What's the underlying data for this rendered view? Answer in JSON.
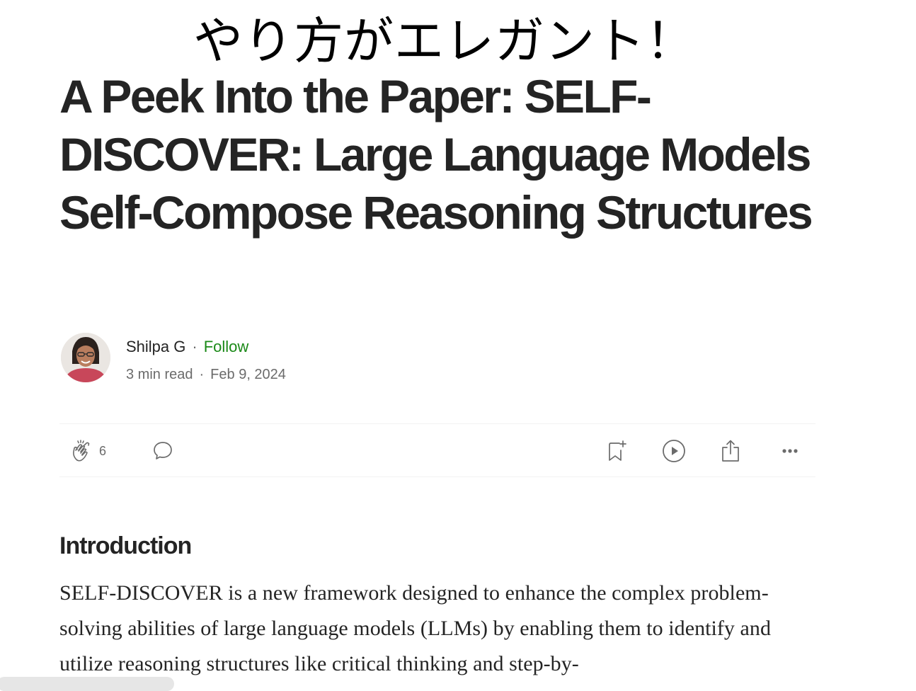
{
  "overlay": {
    "caption": "やり方がエレガント！"
  },
  "article": {
    "title": "A Peek Into the Paper: SELF-DISCOVER: Large Language Models Self-Compose Reasoning Structures",
    "author": {
      "name": "Shilpa G",
      "separator": "·",
      "follow_label": "Follow",
      "avatar_icon": "avatar-photo"
    },
    "meta": {
      "read_time": "3 min read",
      "separator": "·",
      "date": "Feb 9, 2024"
    },
    "actions": {
      "clap_icon": "clap-icon",
      "clap_count": "6",
      "response_icon": "speech-bubble-icon",
      "save_icon": "bookmark-add-icon",
      "listen_icon": "play-circle-icon",
      "share_icon": "share-icon",
      "more_icon": "more-dots-icon"
    },
    "section_heading": "Introduction",
    "body": "SELF-DISCOVER is a new framework designed to enhance the complex problem-solving abilities of large language models (LLMs) by enabling them to identify and utilize reasoning structures like critical thinking and step-by-"
  },
  "colors": {
    "text": "#242424",
    "muted": "#6b6b6b",
    "follow": "#1a8917",
    "divider": "#f2f2f2"
  }
}
